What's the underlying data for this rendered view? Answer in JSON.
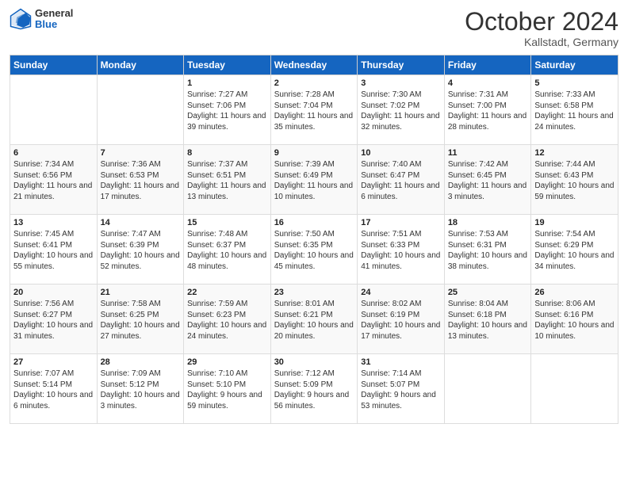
{
  "header": {
    "logo_general": "General",
    "logo_blue": "Blue",
    "month_title": "October 2024",
    "location": "Kallstadt, Germany"
  },
  "days_of_week": [
    "Sunday",
    "Monday",
    "Tuesday",
    "Wednesday",
    "Thursday",
    "Friday",
    "Saturday"
  ],
  "weeks": [
    [
      {
        "day": "",
        "sunrise": "",
        "sunset": "",
        "daylight": ""
      },
      {
        "day": "",
        "sunrise": "",
        "sunset": "",
        "daylight": ""
      },
      {
        "day": "1",
        "sunrise": "Sunrise: 7:27 AM",
        "sunset": "Sunset: 7:06 PM",
        "daylight": "Daylight: 11 hours and 39 minutes."
      },
      {
        "day": "2",
        "sunrise": "Sunrise: 7:28 AM",
        "sunset": "Sunset: 7:04 PM",
        "daylight": "Daylight: 11 hours and 35 minutes."
      },
      {
        "day": "3",
        "sunrise": "Sunrise: 7:30 AM",
        "sunset": "Sunset: 7:02 PM",
        "daylight": "Daylight: 11 hours and 32 minutes."
      },
      {
        "day": "4",
        "sunrise": "Sunrise: 7:31 AM",
        "sunset": "Sunset: 7:00 PM",
        "daylight": "Daylight: 11 hours and 28 minutes."
      },
      {
        "day": "5",
        "sunrise": "Sunrise: 7:33 AM",
        "sunset": "Sunset: 6:58 PM",
        "daylight": "Daylight: 11 hours and 24 minutes."
      }
    ],
    [
      {
        "day": "6",
        "sunrise": "Sunrise: 7:34 AM",
        "sunset": "Sunset: 6:56 PM",
        "daylight": "Daylight: 11 hours and 21 minutes."
      },
      {
        "day": "7",
        "sunrise": "Sunrise: 7:36 AM",
        "sunset": "Sunset: 6:53 PM",
        "daylight": "Daylight: 11 hours and 17 minutes."
      },
      {
        "day": "8",
        "sunrise": "Sunrise: 7:37 AM",
        "sunset": "Sunset: 6:51 PM",
        "daylight": "Daylight: 11 hours and 13 minutes."
      },
      {
        "day": "9",
        "sunrise": "Sunrise: 7:39 AM",
        "sunset": "Sunset: 6:49 PM",
        "daylight": "Daylight: 11 hours and 10 minutes."
      },
      {
        "day": "10",
        "sunrise": "Sunrise: 7:40 AM",
        "sunset": "Sunset: 6:47 PM",
        "daylight": "Daylight: 11 hours and 6 minutes."
      },
      {
        "day": "11",
        "sunrise": "Sunrise: 7:42 AM",
        "sunset": "Sunset: 6:45 PM",
        "daylight": "Daylight: 11 hours and 3 minutes."
      },
      {
        "day": "12",
        "sunrise": "Sunrise: 7:44 AM",
        "sunset": "Sunset: 6:43 PM",
        "daylight": "Daylight: 10 hours and 59 minutes."
      }
    ],
    [
      {
        "day": "13",
        "sunrise": "Sunrise: 7:45 AM",
        "sunset": "Sunset: 6:41 PM",
        "daylight": "Daylight: 10 hours and 55 minutes."
      },
      {
        "day": "14",
        "sunrise": "Sunrise: 7:47 AM",
        "sunset": "Sunset: 6:39 PM",
        "daylight": "Daylight: 10 hours and 52 minutes."
      },
      {
        "day": "15",
        "sunrise": "Sunrise: 7:48 AM",
        "sunset": "Sunset: 6:37 PM",
        "daylight": "Daylight: 10 hours and 48 minutes."
      },
      {
        "day": "16",
        "sunrise": "Sunrise: 7:50 AM",
        "sunset": "Sunset: 6:35 PM",
        "daylight": "Daylight: 10 hours and 45 minutes."
      },
      {
        "day": "17",
        "sunrise": "Sunrise: 7:51 AM",
        "sunset": "Sunset: 6:33 PM",
        "daylight": "Daylight: 10 hours and 41 minutes."
      },
      {
        "day": "18",
        "sunrise": "Sunrise: 7:53 AM",
        "sunset": "Sunset: 6:31 PM",
        "daylight": "Daylight: 10 hours and 38 minutes."
      },
      {
        "day": "19",
        "sunrise": "Sunrise: 7:54 AM",
        "sunset": "Sunset: 6:29 PM",
        "daylight": "Daylight: 10 hours and 34 minutes."
      }
    ],
    [
      {
        "day": "20",
        "sunrise": "Sunrise: 7:56 AM",
        "sunset": "Sunset: 6:27 PM",
        "daylight": "Daylight: 10 hours and 31 minutes."
      },
      {
        "day": "21",
        "sunrise": "Sunrise: 7:58 AM",
        "sunset": "Sunset: 6:25 PM",
        "daylight": "Daylight: 10 hours and 27 minutes."
      },
      {
        "day": "22",
        "sunrise": "Sunrise: 7:59 AM",
        "sunset": "Sunset: 6:23 PM",
        "daylight": "Daylight: 10 hours and 24 minutes."
      },
      {
        "day": "23",
        "sunrise": "Sunrise: 8:01 AM",
        "sunset": "Sunset: 6:21 PM",
        "daylight": "Daylight: 10 hours and 20 minutes."
      },
      {
        "day": "24",
        "sunrise": "Sunrise: 8:02 AM",
        "sunset": "Sunset: 6:19 PM",
        "daylight": "Daylight: 10 hours and 17 minutes."
      },
      {
        "day": "25",
        "sunrise": "Sunrise: 8:04 AM",
        "sunset": "Sunset: 6:18 PM",
        "daylight": "Daylight: 10 hours and 13 minutes."
      },
      {
        "day": "26",
        "sunrise": "Sunrise: 8:06 AM",
        "sunset": "Sunset: 6:16 PM",
        "daylight": "Daylight: 10 hours and 10 minutes."
      }
    ],
    [
      {
        "day": "27",
        "sunrise": "Sunrise: 7:07 AM",
        "sunset": "Sunset: 5:14 PM",
        "daylight": "Daylight: 10 hours and 6 minutes."
      },
      {
        "day": "28",
        "sunrise": "Sunrise: 7:09 AM",
        "sunset": "Sunset: 5:12 PM",
        "daylight": "Daylight: 10 hours and 3 minutes."
      },
      {
        "day": "29",
        "sunrise": "Sunrise: 7:10 AM",
        "sunset": "Sunset: 5:10 PM",
        "daylight": "Daylight: 9 hours and 59 minutes."
      },
      {
        "day": "30",
        "sunrise": "Sunrise: 7:12 AM",
        "sunset": "Sunset: 5:09 PM",
        "daylight": "Daylight: 9 hours and 56 minutes."
      },
      {
        "day": "31",
        "sunrise": "Sunrise: 7:14 AM",
        "sunset": "Sunset: 5:07 PM",
        "daylight": "Daylight: 9 hours and 53 minutes."
      },
      {
        "day": "",
        "sunrise": "",
        "sunset": "",
        "daylight": ""
      },
      {
        "day": "",
        "sunrise": "",
        "sunset": "",
        "daylight": ""
      }
    ]
  ]
}
